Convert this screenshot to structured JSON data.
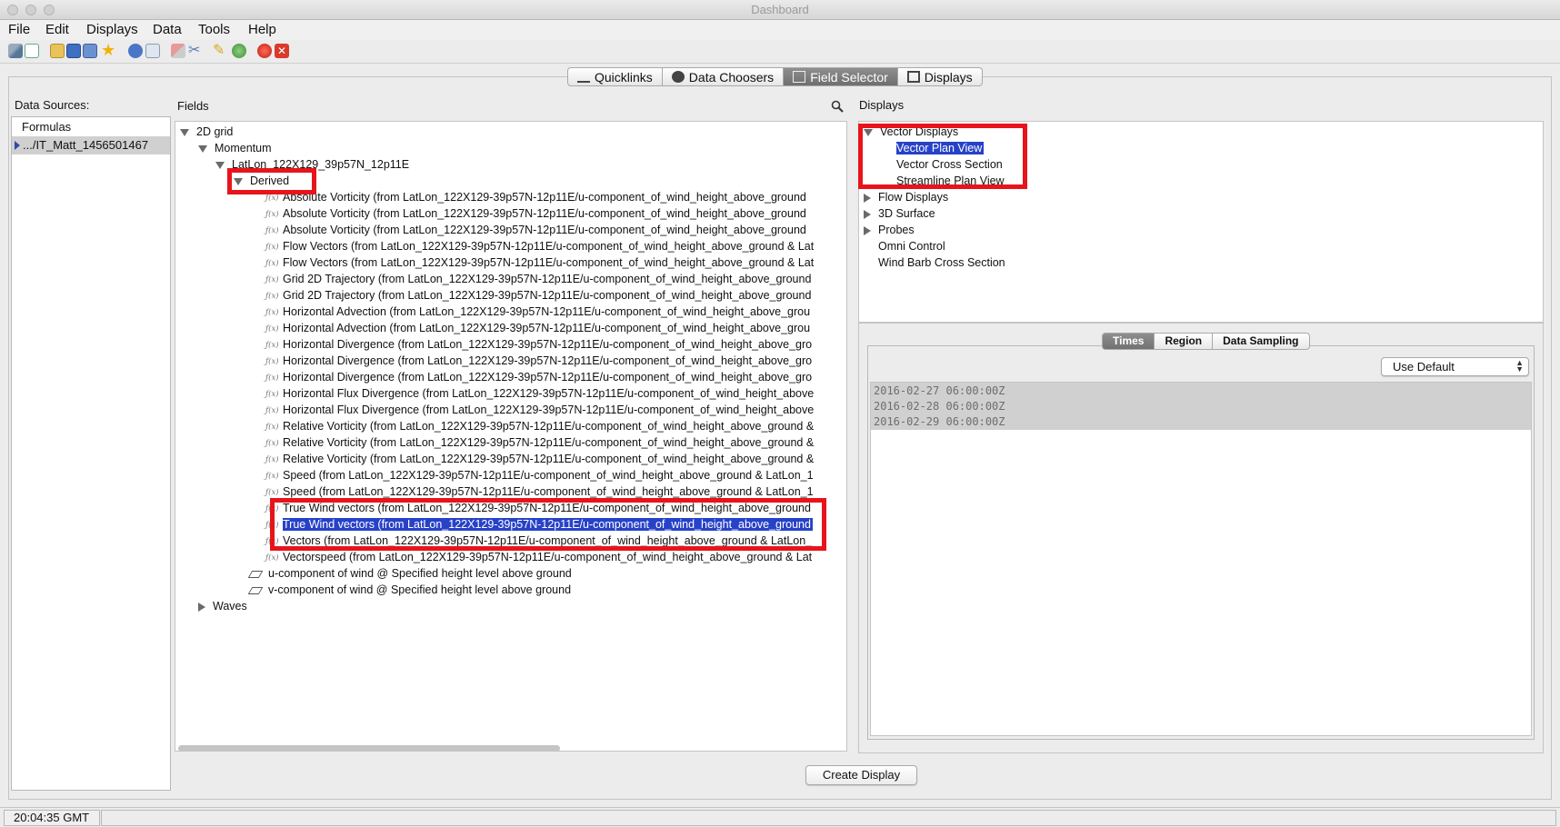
{
  "window": {
    "title": "Dashboard"
  },
  "menu": [
    "File",
    "Edit",
    "Displays",
    "Data",
    "Tools",
    "Help"
  ],
  "toolbar_icons": [
    "open-bundle-icon",
    "new-window-icon",
    "open-folder-icon",
    "save-icon",
    "save-as-icon",
    "favorites-star-icon",
    "help-icon",
    "mail-icon",
    "eraser-icon",
    "scissors-icon",
    "pencil-icon",
    "globe-icon",
    "record-icon",
    "close-window-icon"
  ],
  "tabs": [
    "Quicklinks",
    "Data Choosers",
    "Field Selector",
    "Displays"
  ],
  "data_sources": {
    "label": "Data Sources:",
    "items": [
      "Formulas",
      ".../IT_Matt_1456501467"
    ]
  },
  "fields": {
    "label": "Fields",
    "root": "2D grid",
    "momentum": "Momentum",
    "latlon": "LatLon_122X129_39p57N_12p11E",
    "derived": "Derived",
    "derived_items": [
      "Absolute Vorticity (from LatLon_122X129-39p57N-12p11E/u-component_of_wind_height_above_ground",
      "Absolute Vorticity (from LatLon_122X129-39p57N-12p11E/u-component_of_wind_height_above_ground",
      "Absolute Vorticity (from LatLon_122X129-39p57N-12p11E/u-component_of_wind_height_above_ground",
      "Flow Vectors (from LatLon_122X129-39p57N-12p11E/u-component_of_wind_height_above_ground & Lat",
      "Flow Vectors (from LatLon_122X129-39p57N-12p11E/u-component_of_wind_height_above_ground & Lat",
      "Grid 2D Trajectory (from LatLon_122X129-39p57N-12p11E/u-component_of_wind_height_above_ground",
      "Grid 2D Trajectory (from LatLon_122X129-39p57N-12p11E/u-component_of_wind_height_above_ground",
      "Horizontal Advection (from LatLon_122X129-39p57N-12p11E/u-component_of_wind_height_above_grou",
      "Horizontal Advection (from LatLon_122X129-39p57N-12p11E/u-component_of_wind_height_above_grou",
      "Horizontal Divergence (from LatLon_122X129-39p57N-12p11E/u-component_of_wind_height_above_gro",
      "Horizontal Divergence (from LatLon_122X129-39p57N-12p11E/u-component_of_wind_height_above_gro",
      "Horizontal Divergence (from LatLon_122X129-39p57N-12p11E/u-component_of_wind_height_above_gro",
      "Horizontal Flux Divergence (from LatLon_122X129-39p57N-12p11E/u-component_of_wind_height_above",
      "Horizontal Flux Divergence (from LatLon_122X129-39p57N-12p11E/u-component_of_wind_height_above",
      "Relative Vorticity (from LatLon_122X129-39p57N-12p11E/u-component_of_wind_height_above_ground &",
      "Relative Vorticity (from LatLon_122X129-39p57N-12p11E/u-component_of_wind_height_above_ground &",
      "Relative Vorticity (from LatLon_122X129-39p57N-12p11E/u-component_of_wind_height_above_ground &",
      "Speed (from LatLon_122X129-39p57N-12p11E/u-component_of_wind_height_above_ground & LatLon_1",
      "Speed (from LatLon_122X129-39p57N-12p11E/u-component_of_wind_height_above_ground & LatLon_1",
      "True Wind vectors (from LatLon_122X129-39p57N-12p11E/u-component_of_wind_height_above_ground",
      "True Wind vectors (from LatLon_122X129-39p57N-12p11E/u-component_of_wind_height_above_ground",
      "Vectors (from LatLon_122X129-39p57N-12p11E/u-component_of_wind_height_above_ground & LatLon_",
      "Vectorspeed (from LatLon_122X129-39p57N-12p11E/u-component_of_wind_height_above_ground & Lat"
    ],
    "selected_index": 20,
    "u_component": "u-component of wind @ Specified height level above ground",
    "v_component": "v-component of wind @ Specified height level above ground",
    "waves": "Waves"
  },
  "displays": {
    "label": "Displays",
    "vector_displays": "Vector Displays",
    "vector_items": [
      "Vector Plan View",
      "Vector Cross Section",
      "Streamline Plan View"
    ],
    "selected": "Vector Plan View",
    "collapsed_groups": [
      "Flow Displays",
      "3D Surface",
      "Probes"
    ],
    "leaf_items": [
      "Omni Control",
      "Wind Barb Cross Section"
    ]
  },
  "subtabs": [
    "Times",
    "Region",
    "Data Sampling"
  ],
  "times": {
    "select_value": "Use Default",
    "values": [
      "2016-02-27 06:00:00Z",
      "2016-02-28 06:00:00Z",
      "2016-02-29 06:00:00Z"
    ]
  },
  "create_button": "Create Display",
  "status": {
    "time": "20:04:35 GMT"
  },
  "colors": {
    "selection": "#2742c8",
    "highlight_box": "#e8141b",
    "active_tab": "#7a7a7a"
  }
}
